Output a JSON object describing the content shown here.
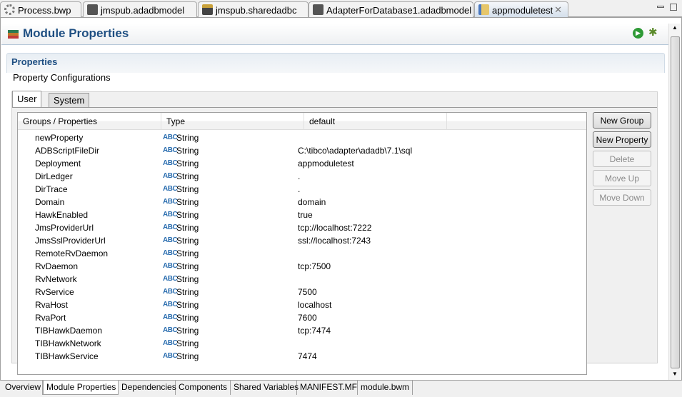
{
  "editor_tabs": [
    {
      "label": "Process.bwp",
      "icon": "gear-icon"
    },
    {
      "label": "jmspub.adadbmodel",
      "icon": "adb-icon"
    },
    {
      "label": "jmspub.sharedadbc",
      "icon": "jdbc-icon"
    },
    {
      "label": "AdapterForDatabase1.adadbmodel",
      "icon": "adb-icon"
    },
    {
      "label": "appmoduletest",
      "icon": "module-icon",
      "active": true
    }
  ],
  "header": {
    "title": "Module Properties"
  },
  "section": {
    "title": "Properties",
    "subtitle": "Property Configurations"
  },
  "property_tabs": [
    "User",
    "System"
  ],
  "table": {
    "columns": [
      "Groups / Properties",
      "Type",
      "default"
    ],
    "rows": [
      {
        "name": "newProperty",
        "type": "String",
        "default": ""
      },
      {
        "name": "ADBScriptFileDir",
        "type": "String",
        "default": "C:\\tibco\\adapter\\adadb\\7.1\\sql"
      },
      {
        "name": "Deployment",
        "type": "String",
        "default": "appmoduletest"
      },
      {
        "name": "DirLedger",
        "type": "String",
        "default": "."
      },
      {
        "name": "DirTrace",
        "type": "String",
        "default": "."
      },
      {
        "name": "Domain",
        "type": "String",
        "default": "domain"
      },
      {
        "name": "HawkEnabled",
        "type": "String",
        "default": "true"
      },
      {
        "name": "JmsProviderUrl",
        "type": "String",
        "default": "tcp://localhost:7222"
      },
      {
        "name": "JmsSslProviderUrl",
        "type": "String",
        "default": "ssl://localhost:7243"
      },
      {
        "name": "RemoteRvDaemon",
        "type": "String",
        "default": ""
      },
      {
        "name": "RvDaemon",
        "type": "String",
        "default": "tcp:7500"
      },
      {
        "name": "RvNetwork",
        "type": "String",
        "default": ""
      },
      {
        "name": "RvService",
        "type": "String",
        "default": "7500"
      },
      {
        "name": "RvaHost",
        "type": "String",
        "default": "localhost"
      },
      {
        "name": "RvaPort",
        "type": "String",
        "default": "7600"
      },
      {
        "name": "TIBHawkDaemon",
        "type": "String",
        "default": "tcp:7474"
      },
      {
        "name": "TIBHawkNetwork",
        "type": "String",
        "default": ""
      },
      {
        "name": "TIBHawkService",
        "type": "String",
        "default": "7474"
      }
    ],
    "type_icon_label": "ABC"
  },
  "buttons": [
    {
      "label": "New Group",
      "enabled": true
    },
    {
      "label": "New Property",
      "enabled": true
    },
    {
      "label": "Delete",
      "enabled": false
    },
    {
      "label": "Move Up",
      "enabled": false
    },
    {
      "label": "Move Down",
      "enabled": false
    }
  ],
  "bottom_tabs": [
    "Overview",
    "Module Properties",
    "Dependencies",
    "Components",
    "Shared Variables",
    "MANIFEST.MF",
    "module.bwm"
  ],
  "bottom_active": "Module Properties"
}
